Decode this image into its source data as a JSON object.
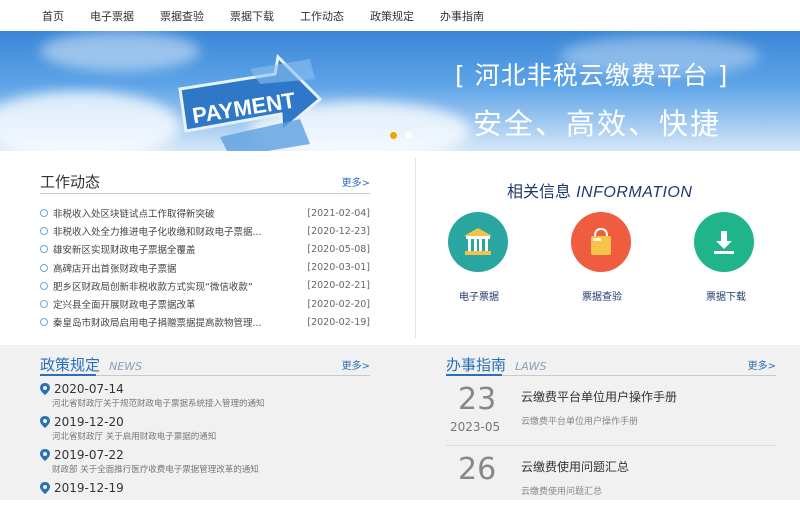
{
  "nav": {
    "items": [
      "首页",
      "电子票据",
      "票据查验",
      "票据下载",
      "工作动态",
      "政策规定",
      "办事指南"
    ]
  },
  "banner": {
    "title": "[ 河北非税云缴费平台 ]",
    "subtitle": "安全、高效、快捷",
    "payment_text": "PAYMENT",
    "slide_count": 2,
    "active_slide": 1
  },
  "work": {
    "title": "工作动态",
    "more": "更多>",
    "items": [
      {
        "text": "非税收入处区块链试点工作取得新突破",
        "date": "[2021-02-04]"
      },
      {
        "text": "非税收入处全力推进电子化收缴和财政电子票据...",
        "date": "[2020-12-23]"
      },
      {
        "text": "雄安新区实现财政电子票据全覆盖",
        "date": "[2020-05-08]"
      },
      {
        "text": "高碑店开出首张财政电子票据",
        "date": "[2020-03-01]"
      },
      {
        "text": "肥乡区财政局创新非税收款方式实现“微信收款”",
        "date": "[2020-02-21]"
      },
      {
        "text": "定兴县全面开展财政电子票据改革",
        "date": "[2020-02-20]"
      },
      {
        "text": "秦皇岛市财政局启用电子捐赠票据提高款物管理...",
        "date": "[2020-02-19]"
      }
    ]
  },
  "info": {
    "title": "相关信息",
    "title_en": "INFORMATION",
    "links": [
      {
        "label": "电子票据",
        "icon": "bank-icon",
        "color": "#2aa6a0"
      },
      {
        "label": "票据查验",
        "icon": "shopping-bag-icon",
        "color": "#ef5c3f"
      },
      {
        "label": "票据下载",
        "icon": "download-icon",
        "color": "#1fb489"
      }
    ]
  },
  "policy": {
    "title": "政策规定",
    "title_en": "NEWS",
    "more": "更多>",
    "items": [
      {
        "date": "2020-07-14",
        "text": "河北省财政厅关于规范财政电子票据系统接入管理的通知"
      },
      {
        "date": "2019-12-20",
        "text": "河北省财政厅 关于启用财政电子票据的通知"
      },
      {
        "date": "2019-07-22",
        "text": "财政部 关于全面推行医疗收费电子票据管理改革的通知"
      },
      {
        "date": "2019-12-19",
        "text": ""
      }
    ]
  },
  "guide": {
    "title": "办事指南",
    "title_en": "LAWS",
    "more": "更多>",
    "items": [
      {
        "day": "23",
        "month": "2023-05",
        "title": "云缴费平台单位用户操作手册",
        "sub": "云缴费平台单位用户操作手册"
      },
      {
        "day": "26",
        "month": "",
        "title": "云缴费使用问题汇总",
        "sub": "云缴费使用问题汇总"
      }
    ]
  },
  "colors": {
    "accent": "#2a6fb8",
    "banner_blue": "#3a86d6",
    "dot_active": "#f0a500"
  }
}
